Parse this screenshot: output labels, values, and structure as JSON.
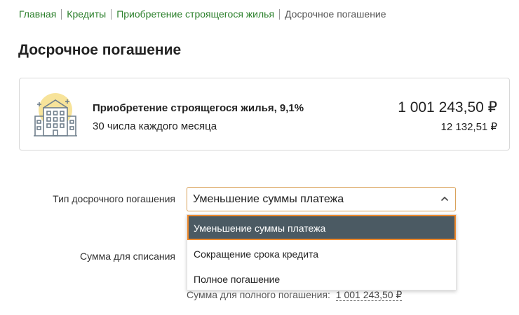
{
  "breadcrumb": {
    "items": [
      "Главная",
      "Кредиты",
      "Приобретение строящегося жилья"
    ],
    "current": "Досрочное погашение"
  },
  "page": {
    "title": "Досрочное погашение"
  },
  "loan": {
    "name": "Приобретение строящегося жилья, 9,1%",
    "payment_day": "30 числа каждого месяца",
    "balance": "1 001 243,50 ₽",
    "monthly_payment": "12 132,51 ₽",
    "icon": "building-icon"
  },
  "form": {
    "type_label": "Тип досрочного погашения",
    "type_value": "Уменьшение суммы платежа",
    "options": [
      "Уменьшение суммы платежа",
      "Сокращение срока кредита",
      "Полное погашение"
    ],
    "amount_label": "Сумма для списания",
    "full_amount_label": "Сумма для полного погашения:",
    "full_amount_value": "1 001 243,50 ₽"
  },
  "colors": {
    "link": "#2a7f2a",
    "selected_option_bg": "#4b5a63",
    "focus_border": "#ef8a2d",
    "icon_sun": "#f7e39a"
  }
}
